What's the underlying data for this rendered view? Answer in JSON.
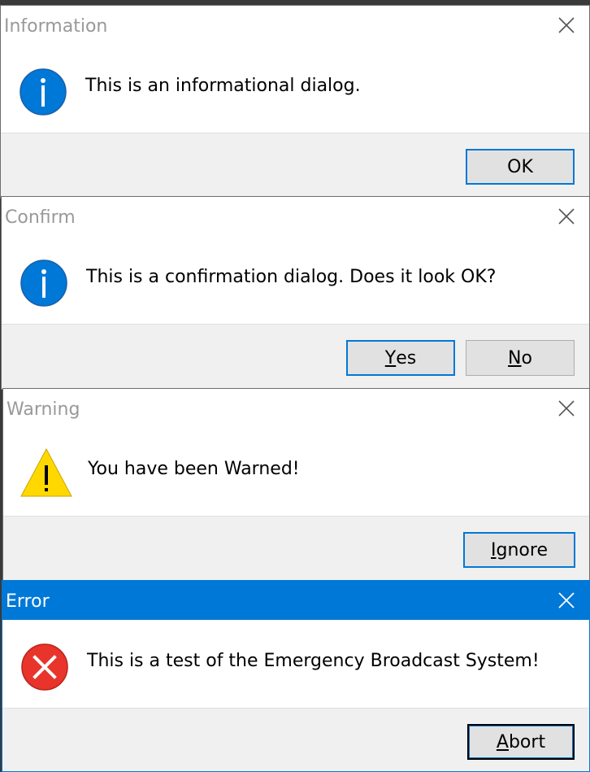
{
  "dialogs": [
    {
      "title": "Information",
      "icon": "info-icon",
      "message": "This is an informational dialog.",
      "buttons": [
        {
          "label": "OK",
          "mnemonic": "",
          "rest": "OK"
        }
      ]
    },
    {
      "title": "Confirm",
      "icon": "info-icon",
      "message": "This is a confirmation dialog. Does it look OK?",
      "buttons": [
        {
          "label": "Yes",
          "mnemonic": "Y",
          "rest": "es"
        },
        {
          "label": "No",
          "mnemonic": "N",
          "rest": "o"
        }
      ]
    },
    {
      "title": "Warning",
      "icon": "warning-icon",
      "message": "You have been Warned!",
      "buttons": [
        {
          "label": "Ignore",
          "mnemonic": "I",
          "rest": "gnore"
        }
      ]
    },
    {
      "title": "Error",
      "icon": "error-icon",
      "message": "This is a test of the Emergency Broadcast System!",
      "buttons": [
        {
          "label": "Abort",
          "mnemonic": "A",
          "rest": "bort"
        }
      ]
    }
  ],
  "colors": {
    "accent": "#0078d7",
    "info": "#0078d7",
    "warning": "#ffd800",
    "error": "#e81123"
  }
}
